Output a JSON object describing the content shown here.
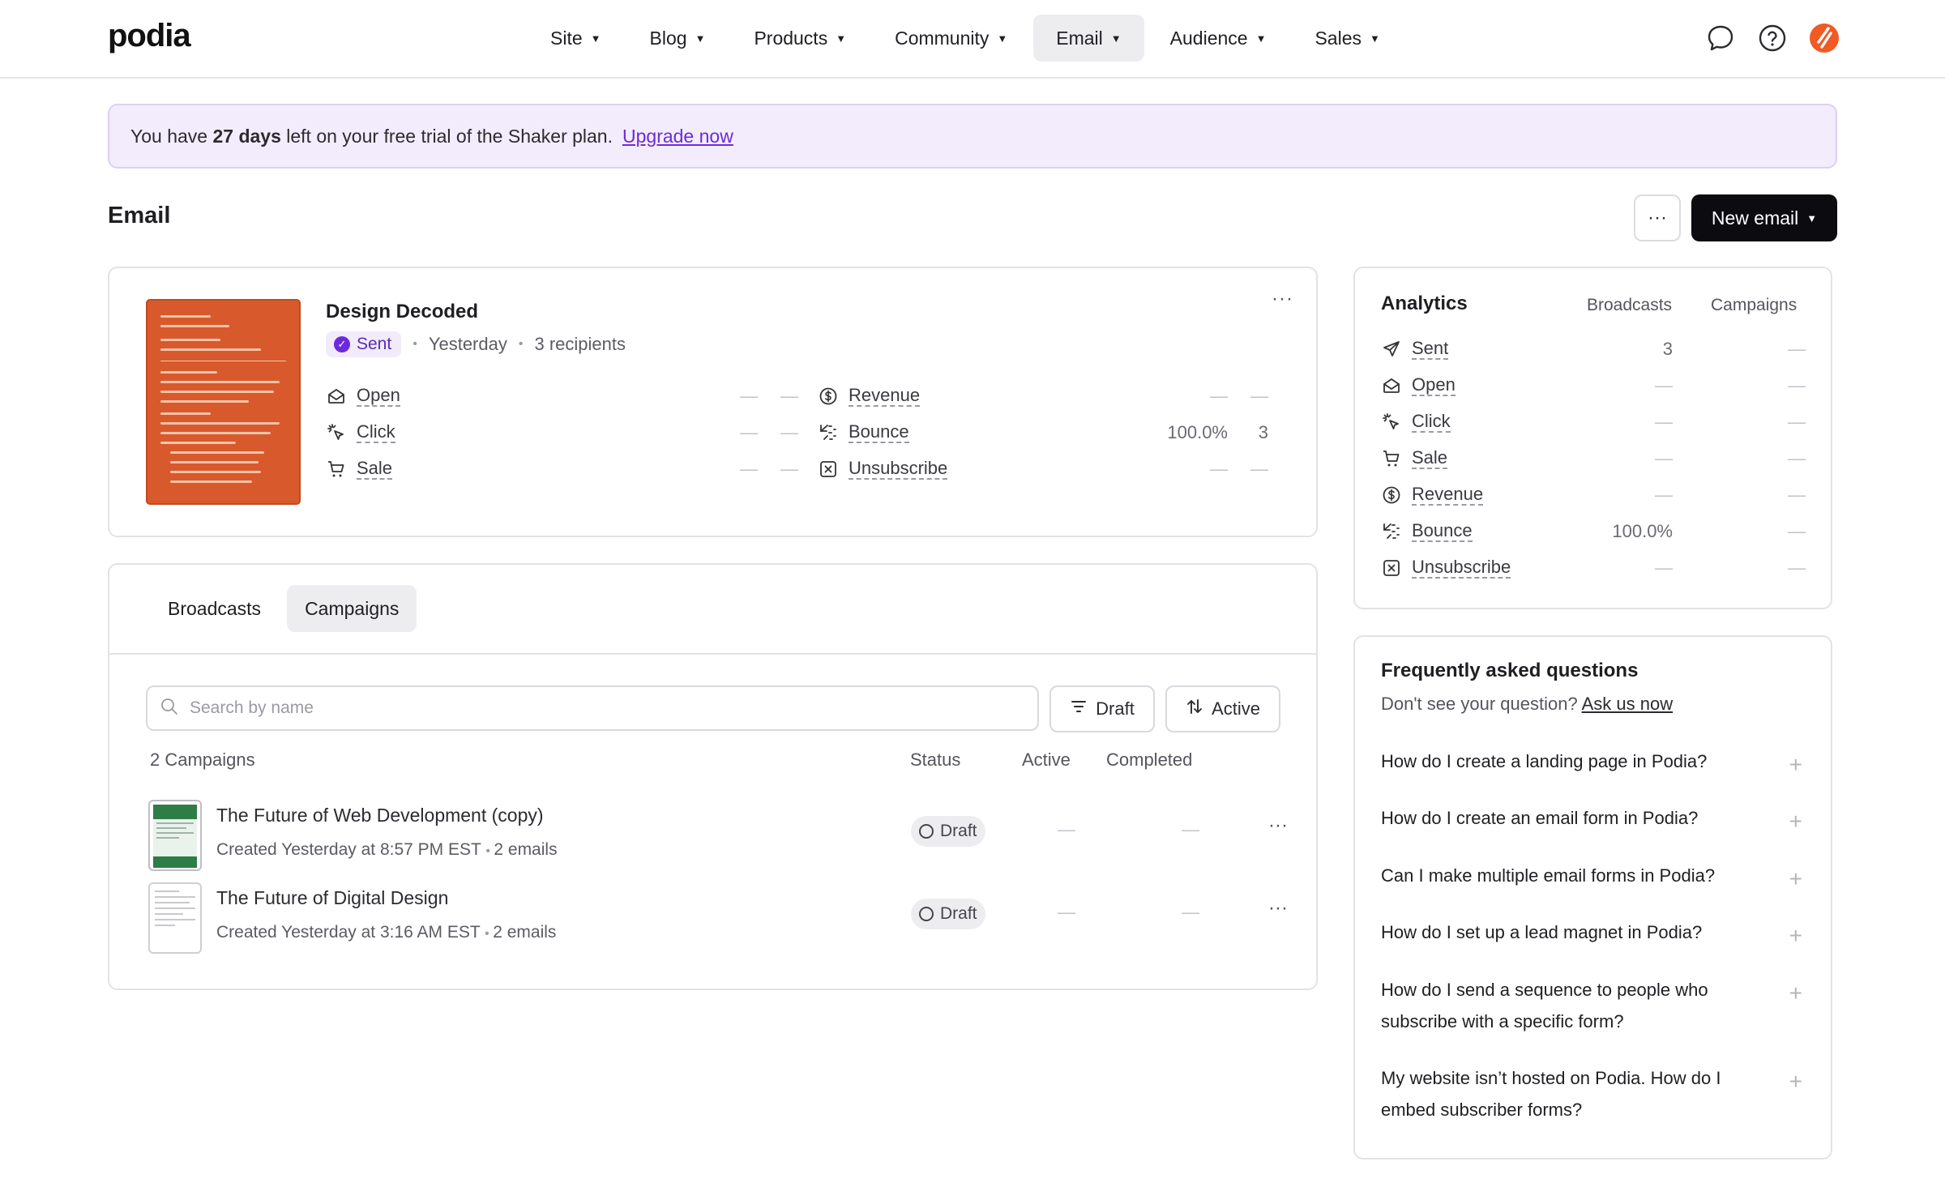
{
  "nav": {
    "logo": "podia",
    "items": [
      {
        "label": "Site"
      },
      {
        "label": "Blog"
      },
      {
        "label": "Products"
      },
      {
        "label": "Community"
      },
      {
        "label": "Email",
        "active": true
      },
      {
        "label": "Audience"
      },
      {
        "label": "Sales"
      }
    ],
    "icons": [
      "chat-icon",
      "help-icon",
      "avatar-icon"
    ]
  },
  "banner": {
    "prefix": "You have ",
    "days": "27 days",
    "suffix": " left on your free trial of the Shaker plan.",
    "link": "Upgrade now"
  },
  "header": {
    "title": "Email",
    "more_label": "···",
    "new_email_label": "New email"
  },
  "broadcast": {
    "title": "Design Decoded",
    "status": "Sent",
    "when": "Yesterday",
    "recipients": "3 recipients",
    "more": "···",
    "metrics_left": [
      {
        "label": "Open",
        "icon": "envelope-open-icon",
        "v1": "—",
        "v2": "—"
      },
      {
        "label": "Click",
        "icon": "cursor-click-icon",
        "v1": "—",
        "v2": "—"
      },
      {
        "label": "Sale",
        "icon": "cart-icon",
        "v1": "—",
        "v2": "—"
      }
    ],
    "metrics_right": [
      {
        "label": "Revenue",
        "icon": "dollar-circle-icon",
        "v1": "—",
        "v2": "—"
      },
      {
        "label": "Bounce",
        "icon": "bounce-icon",
        "v1": "100.0%",
        "v2": "3"
      },
      {
        "label": "Unsubscribe",
        "icon": "x-square-icon",
        "v1": "—",
        "v2": "—"
      }
    ],
    "accent": "#d8592c"
  },
  "campaigns": {
    "tabs": [
      {
        "label": "Broadcasts"
      },
      {
        "label": "Campaigns",
        "active": true
      }
    ],
    "search_placeholder": "Search by name",
    "filter_draft": "Draft",
    "filter_active": "Active",
    "count_label": "2 Campaigns",
    "columns": {
      "status": "Status",
      "active": "Active",
      "completed": "Completed"
    },
    "rows": [
      {
        "title": "The Future of Web Development (copy)",
        "created": "Created Yesterday at 8:57 PM EST",
        "emails": "2 emails",
        "status": "Draft",
        "active": "—",
        "completed": "—",
        "more": "···"
      },
      {
        "title": "The Future of Digital Design",
        "created": "Created Yesterday at 3:16 AM EST",
        "emails": "2 emails",
        "status": "Draft",
        "active": "—",
        "completed": "—",
        "more": "···"
      }
    ]
  },
  "analytics": {
    "title": "Analytics",
    "col_broadcasts": "Broadcasts",
    "col_campaigns": "Campaigns",
    "rows": [
      {
        "label": "Sent",
        "icon": "send-icon",
        "broadcasts": "3",
        "campaigns": "—"
      },
      {
        "label": "Open",
        "icon": "envelope-open-icon",
        "broadcasts": "—",
        "campaigns": "—"
      },
      {
        "label": "Click",
        "icon": "cursor-click-icon",
        "broadcasts": "—",
        "campaigns": "—"
      },
      {
        "label": "Sale",
        "icon": "cart-icon",
        "broadcasts": "—",
        "campaigns": "—"
      },
      {
        "label": "Revenue",
        "icon": "dollar-circle-icon",
        "broadcasts": "—",
        "campaigns": "—"
      },
      {
        "label": "Bounce",
        "icon": "bounce-icon",
        "broadcasts": "100.0%",
        "campaigns": "—"
      },
      {
        "label": "Unsubscribe",
        "icon": "x-square-icon",
        "broadcasts": "—",
        "campaigns": "—"
      }
    ]
  },
  "faq": {
    "title": "Frequently asked questions",
    "sub": "Don't see your question?",
    "link": "Ask us now",
    "items": [
      {
        "q": "How do I create a landing page in Podia?"
      },
      {
        "q": "How do I create an email form in Podia?"
      },
      {
        "q": "Can I make multiple email forms in Podia?"
      },
      {
        "q": "How do I set up a lead magnet in Podia?"
      },
      {
        "q": "How do I send a sequence to people who subscribe with a specific form?"
      },
      {
        "q": "My website isn’t hosted on Podia. How do I embed subscriber forms?"
      }
    ]
  },
  "colors": {
    "purple": "#6c2bd9",
    "banner_bg": "#f3ecfc",
    "primary_button": "#0b0b10"
  }
}
